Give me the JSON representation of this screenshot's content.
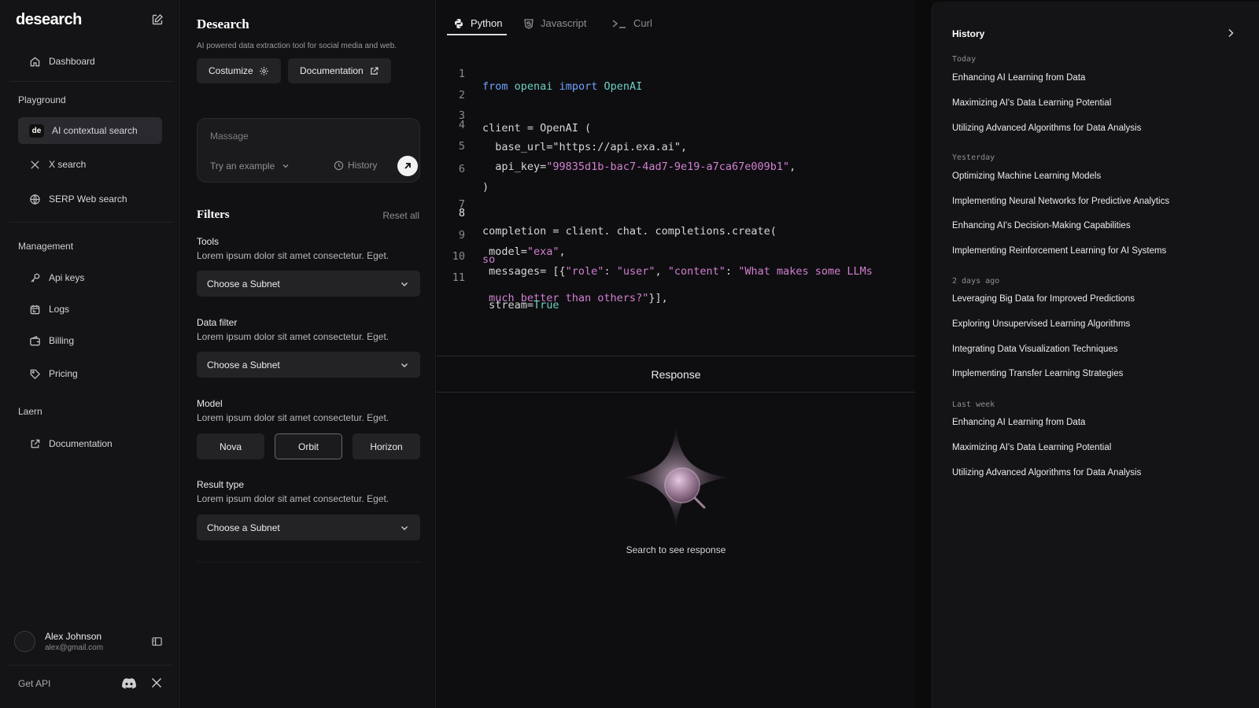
{
  "sidebar": {
    "logo": "desearch",
    "dashboard": "Dashboard",
    "playground_label": "Playground",
    "playground": [
      {
        "label": "AI contextual search",
        "badge": "de"
      },
      {
        "label": "X search"
      },
      {
        "label": "SERP Web search"
      }
    ],
    "management_label": "Management",
    "management": [
      {
        "label": "Api keys"
      },
      {
        "label": "Logs"
      },
      {
        "label": "Billing"
      },
      {
        "label": "Pricing"
      }
    ],
    "learn_label": "Laern",
    "documentation": "Documentation",
    "user": {
      "name": "Alex Johnson",
      "email": "alex@gmail.com"
    },
    "get_api": "Get API"
  },
  "config": {
    "title": "Desearch",
    "subtitle": "AI powered data extraction tool for social media and web.",
    "customize_label": "Costumize",
    "documentation_label": "Documentation",
    "message_placeholder": "Massage",
    "try_example": "Try an example",
    "history_label": "History",
    "filters_title": "Filters",
    "reset_all": "Reset all",
    "tools": {
      "label": "Tools",
      "desc": "Lorem ipsum dolor sit amet consectetur. Eget.",
      "value": "Choose a Subnet"
    },
    "data_filter": {
      "label": "Data filter",
      "desc": "Lorem ipsum dolor sit amet consectetur. Eget.",
      "value": "Choose a Subnet"
    },
    "model": {
      "label": "Model",
      "desc": "Lorem ipsum dolor sit amet consectetur. Eget.",
      "options": [
        "Nova",
        "Orbit",
        "Horizon"
      ],
      "selected": "Orbit"
    },
    "result_type": {
      "label": "Result type",
      "desc": "Lorem ipsum dolor sit amet consectetur. Eget.",
      "value": "Choose a Subnet"
    }
  },
  "code": {
    "tabs": [
      "Python",
      "Javascript",
      "Curl"
    ],
    "active_tab": "Python",
    "current_line": 8,
    "line_numbers": [
      "1",
      "2",
      "3",
      "4",
      "5",
      "6",
      "7",
      "8",
      "9",
      "10",
      "11"
    ],
    "lines": {
      "l1_from": "from",
      "l1_module": "openai",
      "l1_import": "import",
      "l1_class": "OpenAI",
      "l3": "client = OpenAI (",
      "l4": "  base_url=\"https://api.exa.ai\",",
      "l5_key": "  api_key=",
      "l5_val": "\"99835d1b-bac7-4ad7-9e19-a7ca67e009b1\"",
      "l5_end": ",",
      "l6": ")",
      "l8": "completion = client. chat. completions.create(",
      "l9_key": " model=",
      "l9_val": "\"exa\"",
      "l9_end": ",",
      "l10_a": " messages= [{",
      "l10_role_k": "\"role\"",
      "l10_colon1": ": ",
      "l10_role_v": "\"user\"",
      "l10_comma": ", ",
      "l10_content_k": "\"content\"",
      "l10_colon2": ": ",
      "l10_content_v": "\"What makes some LLMs",
      "l10_wrap": "so",
      "l11_a": " much better than others?\"",
      "l11_b": "}],",
      "l12_key": " stream=",
      "l12_val": "True"
    }
  },
  "response": {
    "title": "Response",
    "empty_text": "Search to see response"
  },
  "history": {
    "title": "History",
    "groups": [
      {
        "label": "Today",
        "items": [
          "Enhancing AI Learning from Data",
          "Maximizing AI's Data Learning Potential",
          "Utilizing Advanced Algorithms for Data Analysis"
        ]
      },
      {
        "label": "Yesterday",
        "items": [
          "Optimizing Machine Learning Models",
          "Implementing Neural Networks for Predictive Analytics",
          "Enhancing AI's Decision-Making Capabilities",
          "Implementing Reinforcement Learning for AI Systems"
        ]
      },
      {
        "label": "2 days ago",
        "items": [
          "Leveraging Big Data for Improved Predictions",
          "Exploring Unsupervised Learning Algorithms",
          "Integrating Data Visualization Techniques",
          "Implementing Transfer Learning Strategies"
        ]
      },
      {
        "label": "Last week",
        "items": [
          "Enhancing AI Learning from Data",
          "Maximizing AI's Data Learning Potential",
          "Utilizing Advanced Algorithms for Data Analysis"
        ]
      }
    ]
  },
  "colors": {
    "background": "#0b0b0c",
    "panel": "#141416",
    "keyword": "#6fa3ff",
    "string": "#d27fd0",
    "type": "#6ad0c5"
  },
  "icons": [
    "compose-icon",
    "home-icon",
    "x-logo-icon",
    "globe-icon",
    "key-icon",
    "calendar-icon",
    "wallet-icon",
    "tag-icon",
    "external-link-icon",
    "panel-toggle-icon",
    "discord-icon",
    "gear-icon",
    "chevron-down-icon",
    "clock-icon",
    "arrow-up-right-icon",
    "python-icon",
    "shield-icon",
    "terminal-icon",
    "chevron-right-icon"
  ]
}
